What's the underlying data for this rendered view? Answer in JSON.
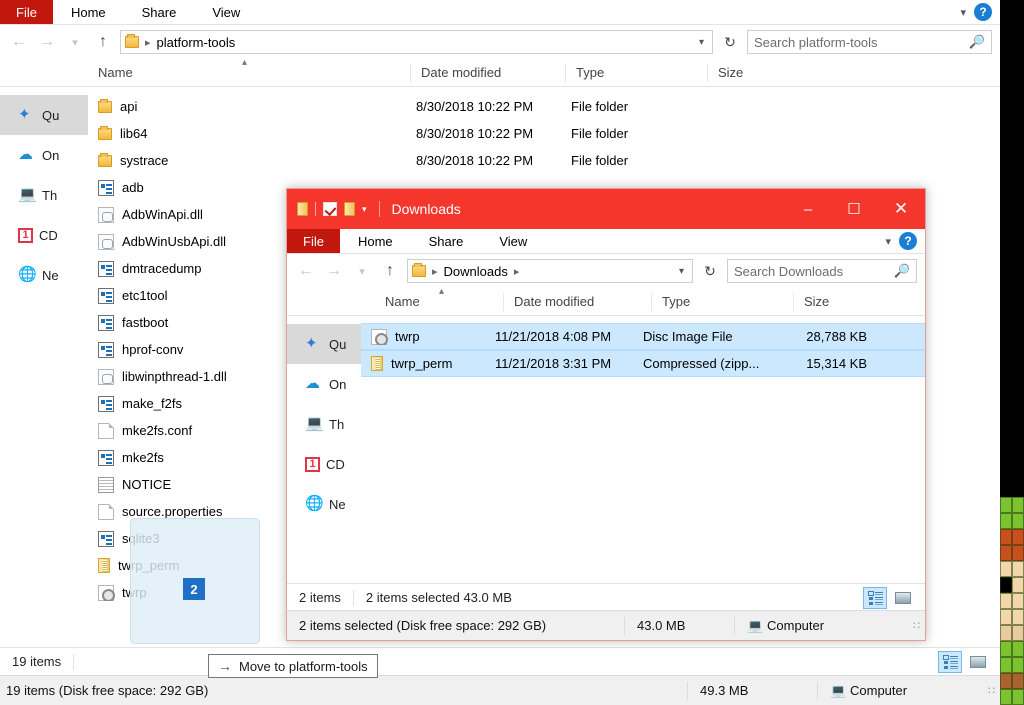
{
  "back_window": {
    "ribbon": {
      "file_label": "File",
      "tabs": [
        "Home",
        "Share",
        "View"
      ],
      "chevron_icon": "chevron-down-icon",
      "help_label": "?"
    },
    "address": {
      "back_icon": "arrow-left-icon",
      "forward_icon": "arrow-right-icon",
      "recent_icon": "chevron-down-icon",
      "up_icon": "arrow-up-icon",
      "folder_icon": "folder-icon",
      "crumb": "platform-tools",
      "caret_icon": "chevron-down-icon",
      "refresh_icon": "refresh-icon",
      "search_placeholder": "Search platform-tools",
      "search_value": "",
      "search_icon": "search-icon"
    },
    "nav_pane": {
      "items": [
        {
          "label": "Qu",
          "icon": "quick-access-star-icon",
          "selected": true
        },
        {
          "label": "On",
          "icon": "onedrive-cloud-icon",
          "selected": false
        },
        {
          "label": "Th",
          "icon": "this-pc-icon",
          "selected": false
        },
        {
          "label": "CD",
          "icon": "oneplus-device-icon",
          "selected": false
        },
        {
          "label": "Ne",
          "icon": "network-icon",
          "selected": false
        }
      ]
    },
    "columns": [
      "Name",
      "Date modified",
      "Type",
      "Size"
    ],
    "sort_caret": "sort-ascending-caret",
    "rows": [
      {
        "name": "api",
        "icon": "folder",
        "date": "8/30/2018 10:22 PM",
        "type": "File folder",
        "size": ""
      },
      {
        "name": "lib64",
        "icon": "folder",
        "date": "8/30/2018 10:22 PM",
        "type": "File folder",
        "size": ""
      },
      {
        "name": "systrace",
        "icon": "folder",
        "date": "8/30/2018 10:22 PM",
        "type": "File folder",
        "size": ""
      },
      {
        "name": "adb",
        "icon": "exe",
        "date": "",
        "type": "",
        "size": ""
      },
      {
        "name": "AdbWinApi.dll",
        "icon": "dll",
        "date": "",
        "type": "",
        "size": ""
      },
      {
        "name": "AdbWinUsbApi.dll",
        "icon": "dll",
        "date": "",
        "type": "",
        "size": ""
      },
      {
        "name": "dmtracedump",
        "icon": "exe",
        "date": "",
        "type": "",
        "size": ""
      },
      {
        "name": "etc1tool",
        "icon": "exe",
        "date": "",
        "type": "",
        "size": ""
      },
      {
        "name": "fastboot",
        "icon": "exe",
        "date": "",
        "type": "",
        "size": ""
      },
      {
        "name": "hprof-conv",
        "icon": "exe",
        "date": "",
        "type": "",
        "size": ""
      },
      {
        "name": "libwinpthread-1.dll",
        "icon": "dll",
        "date": "",
        "type": "",
        "size": ""
      },
      {
        "name": "make_f2fs",
        "icon": "exe",
        "date": "",
        "type": "",
        "size": ""
      },
      {
        "name": "mke2fs.conf",
        "icon": "doc",
        "date": "",
        "type": "",
        "size": ""
      },
      {
        "name": "mke2fs",
        "icon": "exe",
        "date": "",
        "type": "",
        "size": ""
      },
      {
        "name": "NOTICE",
        "icon": "txt",
        "date": "",
        "type": "",
        "size": ""
      },
      {
        "name": "source.properties",
        "icon": "doc",
        "date": "",
        "type": "",
        "size": ""
      },
      {
        "name": "sqlite3",
        "icon": "exe",
        "date": "",
        "type": "",
        "size": ""
      },
      {
        "name": "twrp_perm",
        "icon": "zip",
        "date": "",
        "type": "",
        "size": ""
      },
      {
        "name": "twrp",
        "icon": "disc",
        "date": "",
        "type": "",
        "size": ""
      }
    ],
    "status": {
      "items_count": "19 items",
      "view_details_icon": "details-view-icon",
      "view_large_icon": "large-icons-view-icon"
    },
    "bottom_bar": {
      "items_text": "19 items (Disk free space: 292 GB)",
      "size_text": "49.3 MB",
      "location_icon": "computer-icon",
      "location_text": "Computer",
      "grip_icon": "resize-grip-icon"
    }
  },
  "front_window": {
    "titlebar": {
      "quick_access_icons": [
        "folder-icon",
        "properties-check-icon",
        "folder-icon"
      ],
      "customize_caret_icon": "chevron-down-icon",
      "title": "Downloads",
      "minimize_icon": "minimize-icon",
      "maximize_icon": "maximize-icon",
      "close_icon": "close-icon",
      "minimize_glyph": "–",
      "maximize_glyph": "☐",
      "close_glyph": "✕"
    },
    "ribbon": {
      "file_label": "File",
      "tabs": [
        "Home",
        "Share",
        "View"
      ],
      "chevron_icon": "chevron-down-icon",
      "help_label": "?"
    },
    "address": {
      "back_icon": "arrow-left-icon",
      "forward_icon": "arrow-right-icon",
      "recent_icon": "chevron-down-icon",
      "up_icon": "arrow-up-icon",
      "folder_icon": "folder-icon",
      "crumb": "Downloads",
      "caret_icon": "chevron-down-icon",
      "refresh_icon": "refresh-icon",
      "search_placeholder": "Search Downloads",
      "search_value": "",
      "search_icon": "search-icon"
    },
    "nav_pane": {
      "items": [
        {
          "label": "Qu",
          "icon": "quick-access-star-icon",
          "selected": true
        },
        {
          "label": "On",
          "icon": "onedrive-cloud-icon",
          "selected": false
        },
        {
          "label": "Th",
          "icon": "this-pc-icon",
          "selected": false
        },
        {
          "label": "CD",
          "icon": "oneplus-device-icon",
          "selected": false
        },
        {
          "label": "Ne",
          "icon": "network-icon",
          "selected": false
        }
      ]
    },
    "columns": [
      "Name",
      "Date modified",
      "Type",
      "Size"
    ],
    "sort_caret": "sort-ascending-caret",
    "rows": [
      {
        "name": "twrp",
        "icon": "disc",
        "date": "11/21/2018 4:08 PM",
        "type": "Disc Image File",
        "size": "28,788 KB",
        "selected": true
      },
      {
        "name": "twrp_perm",
        "icon": "zip",
        "date": "11/21/2018 3:31 PM",
        "type": "Compressed (zipp...",
        "size": "15,314 KB",
        "selected": true
      }
    ],
    "status": {
      "items_count": "2 items",
      "selection_text": "2 items selected  43.0 MB",
      "view_details_icon": "details-view-icon",
      "view_large_icon": "large-icons-view-icon"
    },
    "bottom_bar": {
      "items_text": "2 items selected (Disk free space: 292 GB)",
      "size_text": "43.0 MB",
      "location_icon": "computer-icon",
      "location_text": "Computer",
      "grip_icon": "resize-grip-icon"
    }
  },
  "drag": {
    "badge_count": "2",
    "tooltip_arrow_icon": "arrow-right-icon",
    "tooltip_text": "Move to platform-tools"
  },
  "colors": {
    "titlebar_red": "#f4362c",
    "file_tab_red": "#c1170c",
    "selection_blue": "#cce8ff",
    "badge_blue": "#1f6fc4",
    "help_blue": "#1a7fd4"
  },
  "desktop_strip": {
    "rows": [
      [
        "#7cc332",
        "#7cc332"
      ],
      [
        "#7cc332",
        "#7cc332"
      ],
      [
        "#c9501c",
        "#c9501c"
      ],
      [
        "#c9501c",
        "#c9501c"
      ],
      [
        "#f2d7ab",
        "#f2d7ab"
      ],
      [
        "#000000",
        "#f2d7ab"
      ],
      [
        "#f2d7ab",
        "#f2d7ab"
      ],
      [
        "#f2d7ab",
        "#f2d7ab"
      ],
      [
        "#e8cb9f",
        "#e8cb9f"
      ],
      [
        "#7cc332",
        "#7cc332"
      ],
      [
        "#7cc332",
        "#7cc332"
      ],
      [
        "#a8632e",
        "#a8632e"
      ],
      [
        "#7cc332",
        "#7cc332"
      ]
    ]
  }
}
